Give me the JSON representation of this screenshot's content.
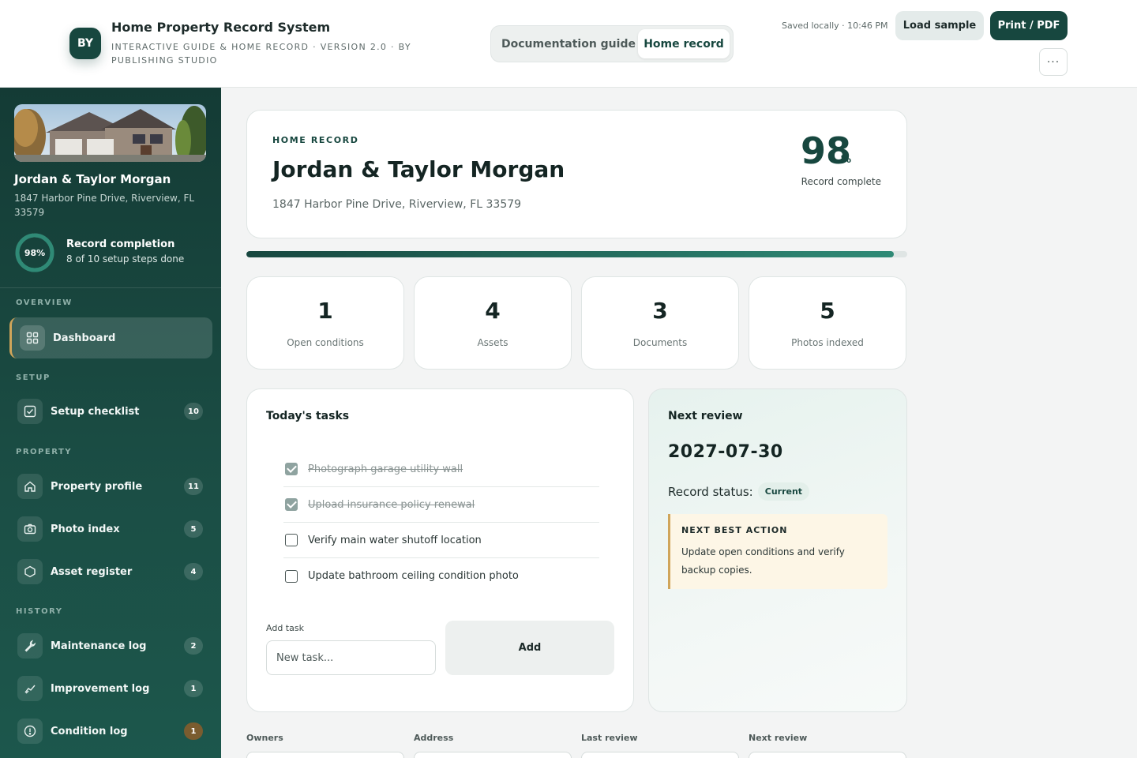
{
  "header": {
    "badge": "BY",
    "title": "Home Property Record System",
    "subtitle": "INTERACTIVE GUIDE & HOME RECORD · VERSION 2.0 · BY PUBLISHING STUDIO",
    "tabs": [
      {
        "label": "Documentation guide",
        "active": false
      },
      {
        "label": "Home record",
        "active": true
      }
    ],
    "saved_status": "Saved locally · 10:46 PM",
    "load_sample_label": "Load sample",
    "print_label": "Print / PDF",
    "more_label": "···"
  },
  "sidebar": {
    "owner_name": "Jordan & Taylor Morgan",
    "address": "1847 Harbor Pine Drive, Riverview, FL 33579",
    "completion_percent_label": "98%",
    "completion_value": 0.98,
    "completion_title": "Record completion",
    "completion_sub": "8 of 10 setup steps done",
    "sections": {
      "overview": "OVERVIEW",
      "setup": "SETUP",
      "property": "PROPERTY",
      "history": "HISTORY"
    },
    "items": [
      {
        "label": "Dashboard",
        "badge": "",
        "icon": "grid-icon",
        "active": true
      },
      {
        "label": "Setup checklist",
        "badge": "10",
        "icon": "checklist-icon"
      },
      {
        "label": "Property profile",
        "badge": "11",
        "icon": "home-icon"
      },
      {
        "label": "Photo index",
        "badge": "5",
        "icon": "camera-icon"
      },
      {
        "label": "Asset register",
        "badge": "4",
        "icon": "hexagon-icon"
      },
      {
        "label": "Maintenance log",
        "badge": "2",
        "icon": "wrench-icon"
      },
      {
        "label": "Improvement log",
        "badge": "1",
        "icon": "trend-icon"
      },
      {
        "label": "Condition log",
        "badge": "1",
        "icon": "alert-icon"
      }
    ]
  },
  "hero": {
    "eyebrow": "HOME RECORD",
    "title": "Jordan & Taylor Morgan",
    "address": "1847 Harbor Pine Drive, Riverview, FL 33579",
    "percent": "98",
    "percent_symbol": "%",
    "percent_label": "Record complete",
    "progress": 0.98
  },
  "stats": [
    {
      "value": "1",
      "label": "Open conditions"
    },
    {
      "value": "4",
      "label": "Assets"
    },
    {
      "value": "3",
      "label": "Documents"
    },
    {
      "value": "5",
      "label": "Photos indexed"
    }
  ],
  "tasks": {
    "title": "Today's tasks",
    "items": [
      {
        "text": "Photograph garage utility wall",
        "done": true
      },
      {
        "text": "Upload insurance policy renewal",
        "done": true
      },
      {
        "text": "Verify main water shutoff location",
        "done": false
      },
      {
        "text": "Update bathroom ceiling condition photo",
        "done": false
      }
    ],
    "add_label": "Add task",
    "add_placeholder": "New task...",
    "add_button": "Add"
  },
  "review": {
    "title": "Next review",
    "date": "2027-07-30",
    "status_label": "Record status:",
    "status_value": "Current",
    "next_action_title": "NEXT BEST ACTION",
    "next_action_body": "Update open conditions and verify backup copies."
  },
  "fields": [
    {
      "label": "Owners"
    },
    {
      "label": "Address"
    },
    {
      "label": "Last review"
    },
    {
      "label": "Next review"
    }
  ],
  "colors": {
    "brand": "#17473f",
    "accent": "#d0a55a",
    "progress_end": "#2f8a76"
  }
}
